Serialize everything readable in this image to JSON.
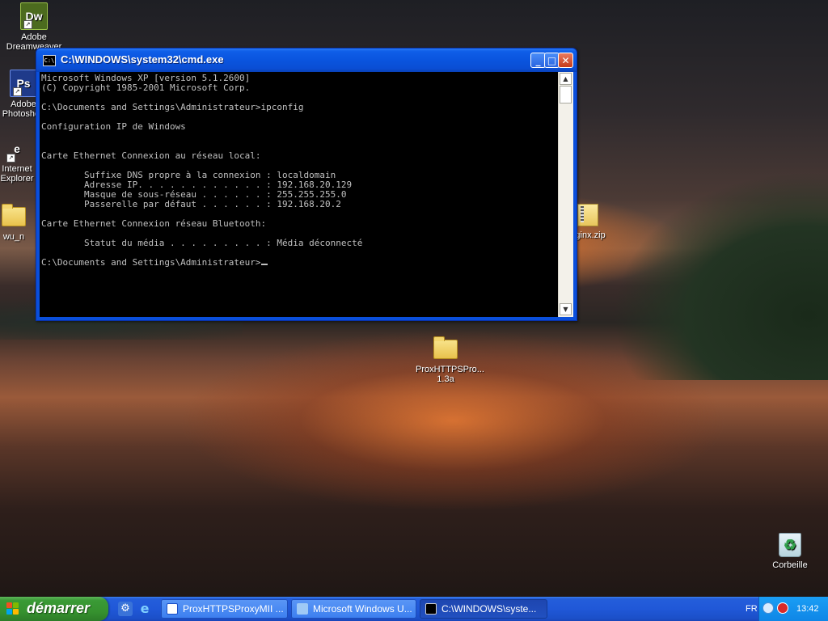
{
  "desktop": {
    "icons": [
      {
        "label": "Adobe Dreamweaver"
      },
      {
        "label": "Adobe Photoshop"
      },
      {
        "label": "Internet Explorer"
      },
      {
        "label": "wu_n"
      },
      {
        "label": "nginx.zip"
      },
      {
        "label": "ProxHTTPSPro... 1.3a"
      },
      {
        "label": "Corbeille"
      }
    ],
    "icon_glyphs": {
      "dw": "Dw",
      "ps": "Ps"
    }
  },
  "cmd_window": {
    "title": "C:\\WINDOWS\\system32\\cmd.exe",
    "icon_text": "C:\\",
    "lines": [
      "Microsoft Windows XP [version 5.1.2600]",
      "(C) Copyright 1985-2001 Microsoft Corp.",
      "",
      "C:\\Documents and Settings\\Administrateur>ipconfig",
      "",
      "Configuration IP de Windows",
      "",
      "",
      "Carte Ethernet Connexion au réseau local:",
      "",
      "        Suffixe DNS propre à la connexion : localdomain",
      "        Adresse IP. . . . . . . . . . . . : 192.168.20.129",
      "        Masque de sous-réseau . . . . . . : 255.255.255.0",
      "        Passerelle par défaut . . . . . . : 192.168.20.2",
      "",
      "Carte Ethernet Connexion réseau Bluetooth:",
      "",
      "        Statut du média . . . . . . . . . : Média déconnecté",
      "",
      "C:\\Documents and Settings\\Administrateur>"
    ],
    "buttons": {
      "minimize": "_",
      "maximize": "□",
      "close": "✕"
    }
  },
  "taskbar": {
    "start_label": "démarrer",
    "tasks": [
      {
        "label": "ProxHTTPSProxyMII ..."
      },
      {
        "label": "Microsoft Windows U..."
      },
      {
        "label": "C:\\WINDOWS\\syste..."
      }
    ],
    "language": "FR",
    "clock": "13:42"
  },
  "colors": {
    "xp_blue": "#0a4fdb",
    "start_green": "#3a9a36",
    "console_text": "#c0c0c0",
    "console_bg": "#000000"
  }
}
